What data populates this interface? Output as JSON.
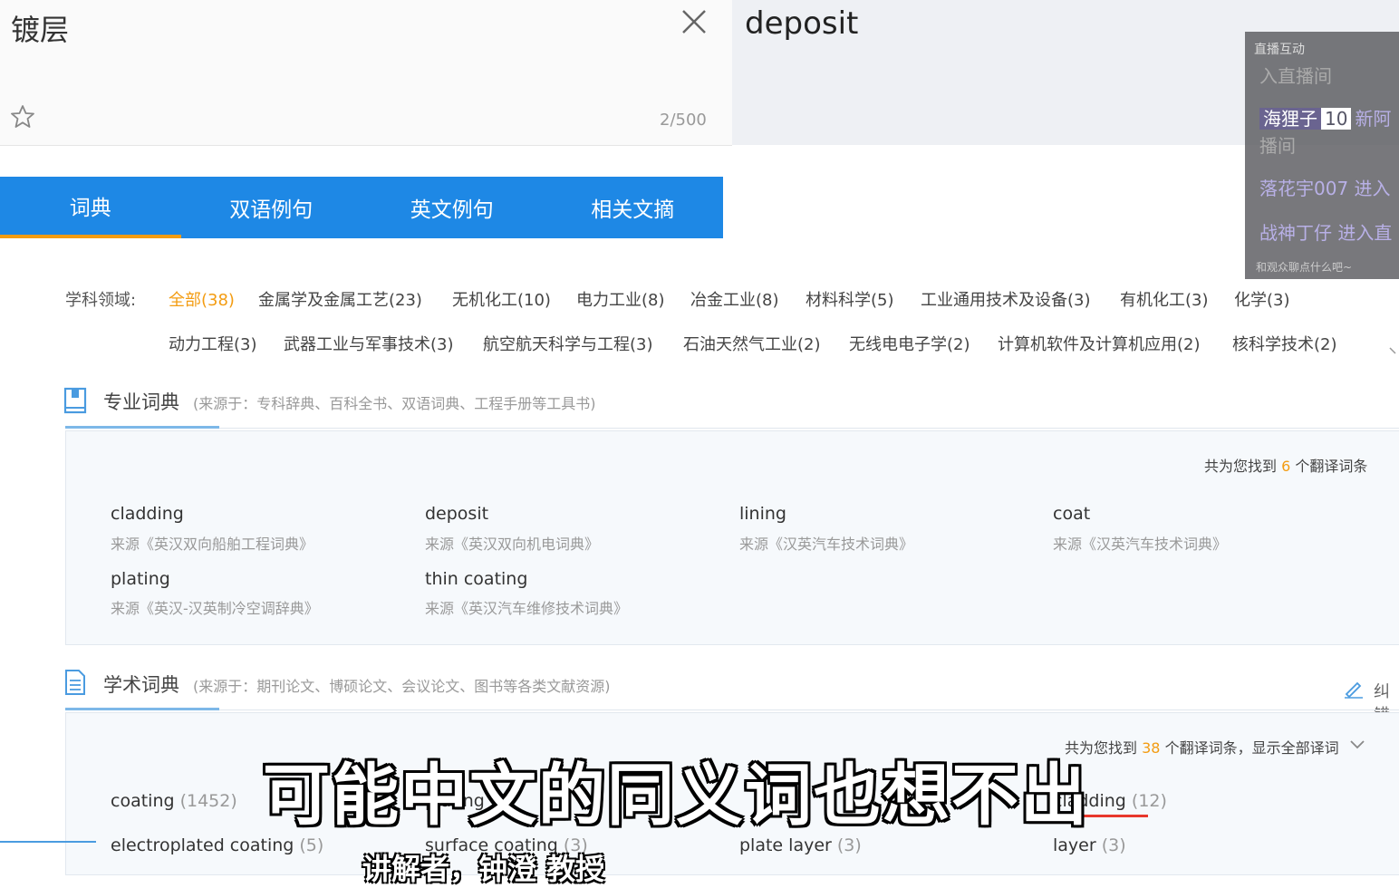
{
  "source": {
    "text": "镀层",
    "counter": "2/500"
  },
  "target": {
    "text": "deposit"
  },
  "tabs": [
    "词典",
    "双语例句",
    "英文例句",
    "相关文摘"
  ],
  "subjects": {
    "label": "学科领域:",
    "row1": [
      "全部(38)",
      "金属学及金属工艺(23)",
      "无机化工(10)",
      "电力工业(8)",
      "冶金工业(8)",
      "材料科学(5)",
      "工业通用技术及设备(3)",
      "有机化工(3)",
      "化学(3)"
    ],
    "row2": [
      "动力工程(3)",
      "武器工业与军事技术(3)",
      "航空航天科学与工程(3)",
      "石油天然气工业(2)",
      "无线电电子学(2)",
      "计算机软件及计算机应用(2)",
      "核科学技术(2)"
    ]
  },
  "professional": {
    "title": "专业词典",
    "source_note": "(来源于：专科辞典、百科全书、双语词典、工程手册等工具书)",
    "found_prefix": "共为您找到",
    "found_count": "6",
    "found_suffix": "个翻译词条",
    "terms": [
      {
        "term": "cladding",
        "source": "来源《英汉双向船舶工程词典》"
      },
      {
        "term": "deposit",
        "source": "来源《英汉双向机电词典》"
      },
      {
        "term": "lining",
        "source": "来源《汉英汽车技术词典》"
      },
      {
        "term": "coat",
        "source": "来源《汉英汽车技术词典》"
      },
      {
        "term": "plating",
        "source": "来源《英汉-汉英制冷空调辞典》"
      },
      {
        "term": "thin coating",
        "source": "来源《英汉汽车维修技术词典》"
      }
    ]
  },
  "academic": {
    "title": "学术词典",
    "source_note": "(来源于：期刊论文、博硕论文、会议论文、图书等各类文献资源)",
    "correct_label": "纠错",
    "found_prefix": "共为您找到",
    "found_count": "38",
    "found_suffix": "个翻译词条，显示全部译词",
    "terms": [
      {
        "term": "coating",
        "count": "(1452)"
      },
      {
        "term": "plating",
        "count": ""
      },
      {
        "term": "",
        "count": ""
      },
      {
        "term": "cladding",
        "count": "(12)"
      },
      {
        "term": "electroplated coating",
        "count": "(5)"
      },
      {
        "term": "surface coating",
        "count": "(3)"
      },
      {
        "term": "plate layer",
        "count": "(3)"
      },
      {
        "term": "layer",
        "count": "(3)"
      }
    ]
  },
  "live_overlay": {
    "title": "直播互动",
    "line1": "入直播间",
    "user1": "海狸子",
    "badge": "10",
    "user1_text": "新阿",
    "line3": "播间",
    "line4": "落花宇007 进入",
    "line5": "战神丁仔 进入直",
    "footer": "和观众聊点什么吧~"
  },
  "subtitle": "可能中文的同义词也想不出",
  "subtitle2": "讲解者，钟澄 教授"
}
